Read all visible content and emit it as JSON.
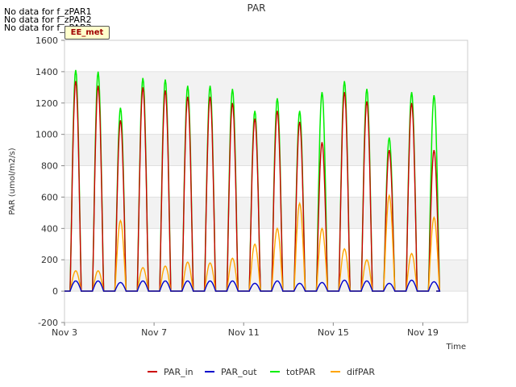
{
  "messages": [
    "No data for f_zPAR1",
    "No data for f_zPAR2",
    "No data for f_zPAR3"
  ],
  "badge": "EE_met",
  "colors": {
    "PAR_in": "#cc0000",
    "PAR_out": "#0000cc",
    "totPAR": "#00ee00",
    "difPAR": "#ffa500",
    "band": "#f2f2f2"
  },
  "chart_data": {
    "type": "line",
    "title": "PAR",
    "xlabel": "Time",
    "ylabel": "PAR (umol/m2/s)",
    "ylim": [
      -200,
      1600
    ],
    "yticks": [
      -200,
      0,
      200,
      400,
      600,
      800,
      1000,
      1200,
      1400,
      1600
    ],
    "xlim": [
      3,
      21
    ],
    "xticks": [
      {
        "value": 3,
        "label": "Nov 3"
      },
      {
        "value": 7,
        "label": "Nov 7"
      },
      {
        "value": 11,
        "label": "Nov 11"
      },
      {
        "value": 15,
        "label": "Nov 15"
      },
      {
        "value": 19,
        "label": "Nov 19"
      }
    ],
    "legend_position": "bottom",
    "series_names": [
      "PAR_in",
      "PAR_out",
      "totPAR",
      "difPAR"
    ],
    "days": [
      {
        "day": 3,
        "totPAR": 1410,
        "PAR_in": 1340,
        "PAR_out": 65,
        "difPAR": 130
      },
      {
        "day": 4,
        "totPAR": 1400,
        "PAR_in": 1310,
        "PAR_out": 65,
        "difPAR": 130
      },
      {
        "day": 5,
        "totPAR": 1170,
        "PAR_in": 1090,
        "PAR_out": 55,
        "difPAR": 450
      },
      {
        "day": 6,
        "totPAR": 1360,
        "PAR_in": 1300,
        "PAR_out": 65,
        "difPAR": 150
      },
      {
        "day": 7,
        "totPAR": 1350,
        "PAR_in": 1280,
        "PAR_out": 65,
        "difPAR": 160
      },
      {
        "day": 8,
        "totPAR": 1310,
        "PAR_in": 1240,
        "PAR_out": 65,
        "difPAR": 185
      },
      {
        "day": 9,
        "totPAR": 1310,
        "PAR_in": 1240,
        "PAR_out": 65,
        "difPAR": 180
      },
      {
        "day": 10,
        "totPAR": 1290,
        "PAR_in": 1200,
        "PAR_out": 65,
        "difPAR": 210
      },
      {
        "day": 11,
        "totPAR": 1150,
        "PAR_in": 1100,
        "PAR_out": 50,
        "difPAR": 300
      },
      {
        "day": 12,
        "totPAR": 1230,
        "PAR_in": 1150,
        "PAR_out": 65,
        "difPAR": 400
      },
      {
        "day": 13,
        "totPAR": 1150,
        "PAR_in": 1080,
        "PAR_out": 50,
        "difPAR": 560
      },
      {
        "day": 14,
        "totPAR": 1270,
        "PAR_in": 950,
        "PAR_out": 55,
        "difPAR": 400
      },
      {
        "day": 15,
        "totPAR": 1340,
        "PAR_in": 1270,
        "PAR_out": 70,
        "difPAR": 270
      },
      {
        "day": 16,
        "totPAR": 1290,
        "PAR_in": 1210,
        "PAR_out": 65,
        "difPAR": 200
      },
      {
        "day": 17,
        "totPAR": 980,
        "PAR_in": 900,
        "PAR_out": 50,
        "difPAR": 610
      },
      {
        "day": 18,
        "totPAR": 1270,
        "PAR_in": 1200,
        "PAR_out": 70,
        "difPAR": 240
      },
      {
        "day": 19,
        "totPAR": 1250,
        "PAR_in": 900,
        "PAR_out": 60,
        "difPAR": 470
      }
    ]
  }
}
